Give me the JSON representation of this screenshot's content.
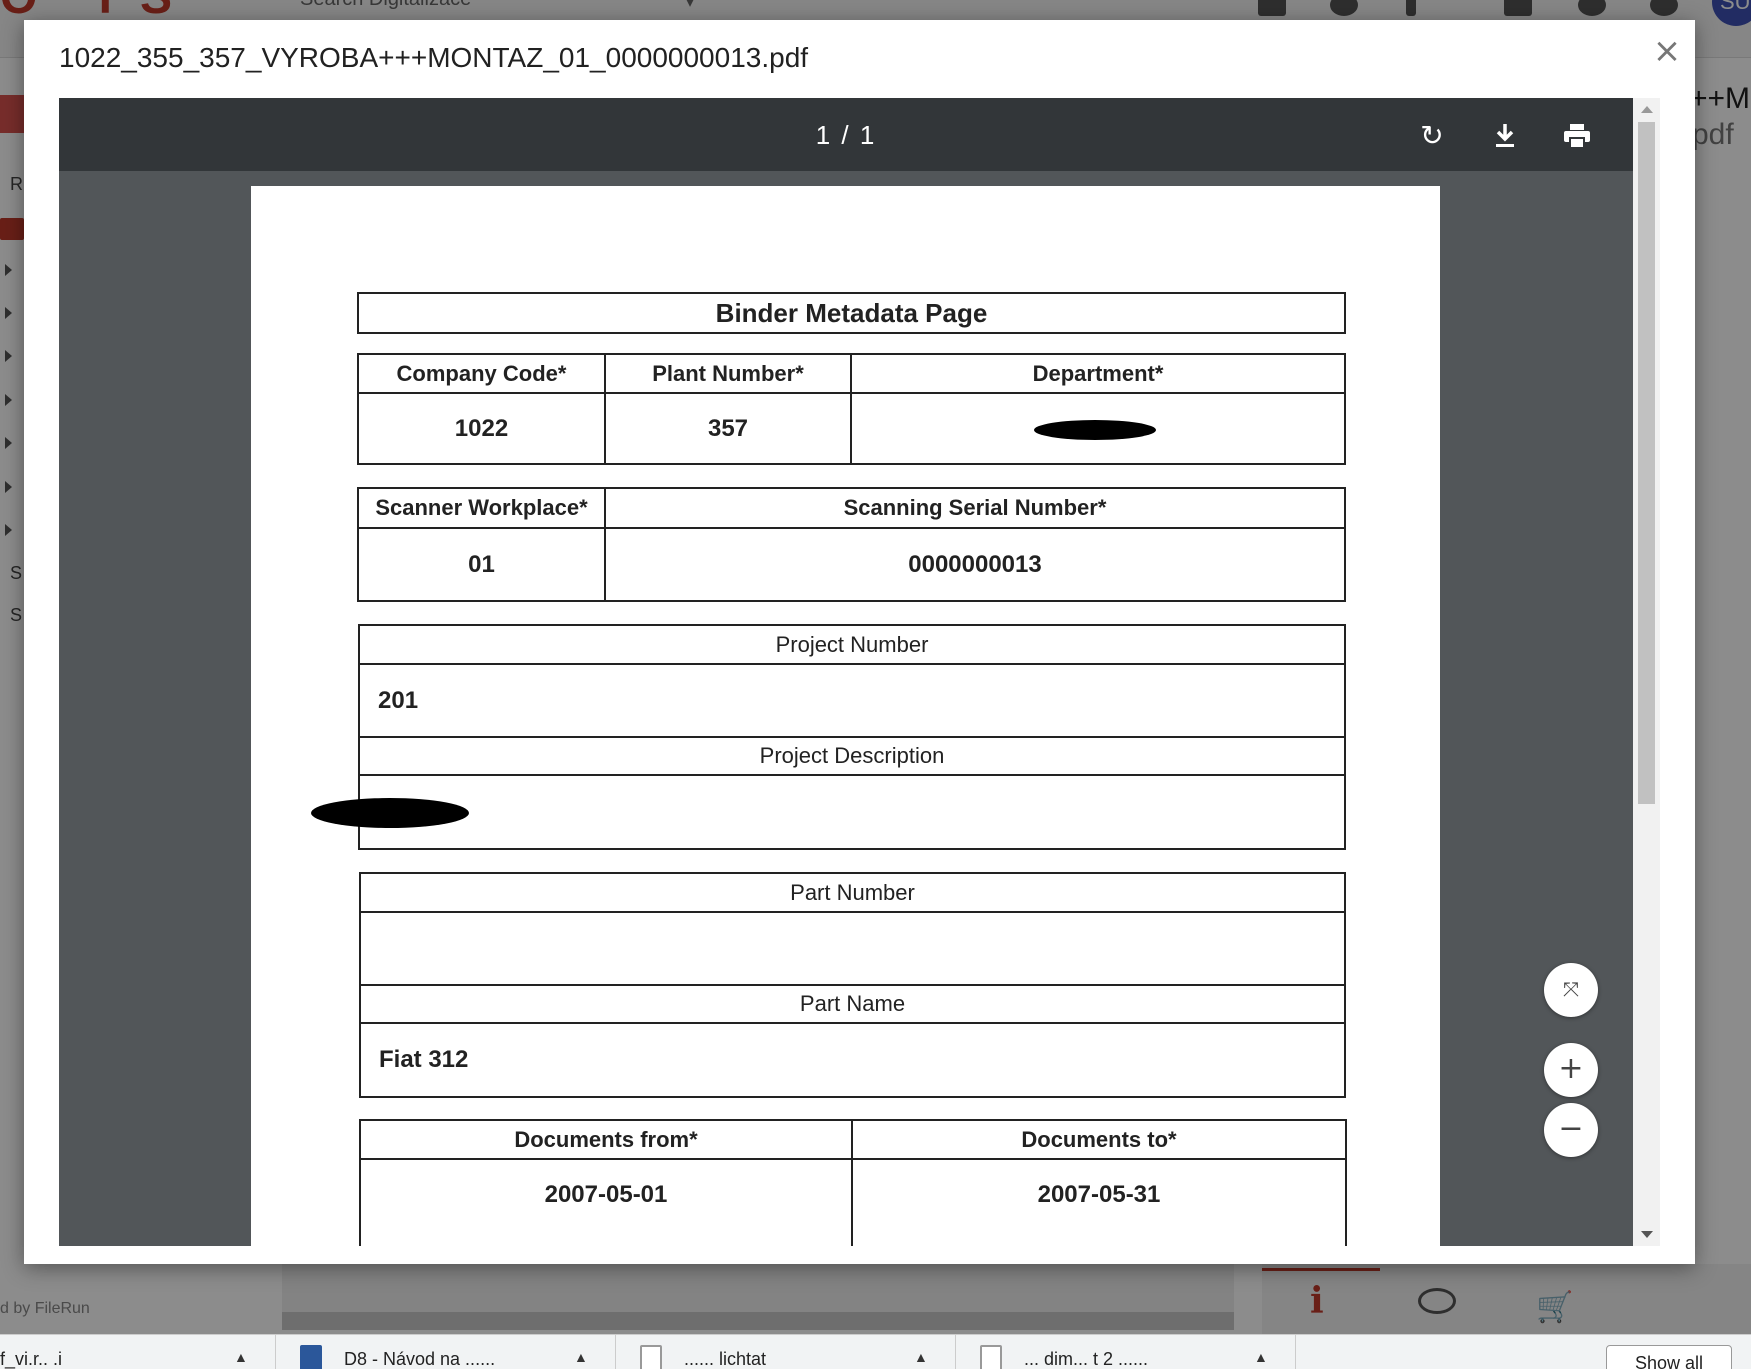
{
  "background": {
    "search_placeholder": "Search Digitalizace",
    "logo_text": "O TS",
    "avatar_initials": "SU",
    "sidebar_letters": [
      "R",
      "S",
      "S"
    ],
    "right_title": "++M",
    "right_subtitle": "pdf",
    "powered_by": "d by FileRun",
    "downloads": [
      {
        "label": "f_vi.r.. .i",
        "icon": "file-icon"
      },
      {
        "label": "D8 - Návod na ......",
        "icon": "word-doc-icon"
      },
      {
        "label": "...... lichtat",
        "icon": "file-icon"
      },
      {
        "label": "... dim... t 2 ......",
        "icon": "file-icon"
      }
    ],
    "show_all_label": "Show all"
  },
  "modal": {
    "title": "1022_355_357_VYROBA+++MONTAZ_01_0000000013.pdf",
    "close_icon": "close-icon"
  },
  "viewer": {
    "page_indicator": "1 / 1",
    "toolbar_icons": [
      "rotate-icon",
      "download-icon",
      "print-icon"
    ],
    "fab_icons": [
      "fit-page-icon",
      "zoom-in-icon",
      "zoom-out-icon"
    ]
  },
  "document": {
    "heading": "Binder Metadata Page",
    "company_code_label": "Company Code*",
    "company_code_value": "1022",
    "plant_number_label": "Plant Number*",
    "plant_number_value": "357",
    "department_label": "Department*",
    "scanner_workplace_label": "Scanner Workplace*",
    "scanner_workplace_value": "01",
    "scanning_serial_label": "Scanning Serial Number*",
    "scanning_serial_value": "0000000013",
    "project_number_label": "Project Number",
    "project_number_value": "201",
    "project_description_label": "Project Description",
    "part_number_label": "Part Number",
    "part_number_value": "",
    "part_name_label": "Part Name",
    "part_name_value": "Fiat 312",
    "documents_from_label": "Documents from*",
    "documents_from_value": "2007-05-01",
    "documents_to_label": "Documents to*",
    "documents_to_value": "2007-05-31"
  },
  "colors": {
    "toolbar": "#323639",
    "viewer_bg": "#525659",
    "brand_red": "#c0392b"
  }
}
